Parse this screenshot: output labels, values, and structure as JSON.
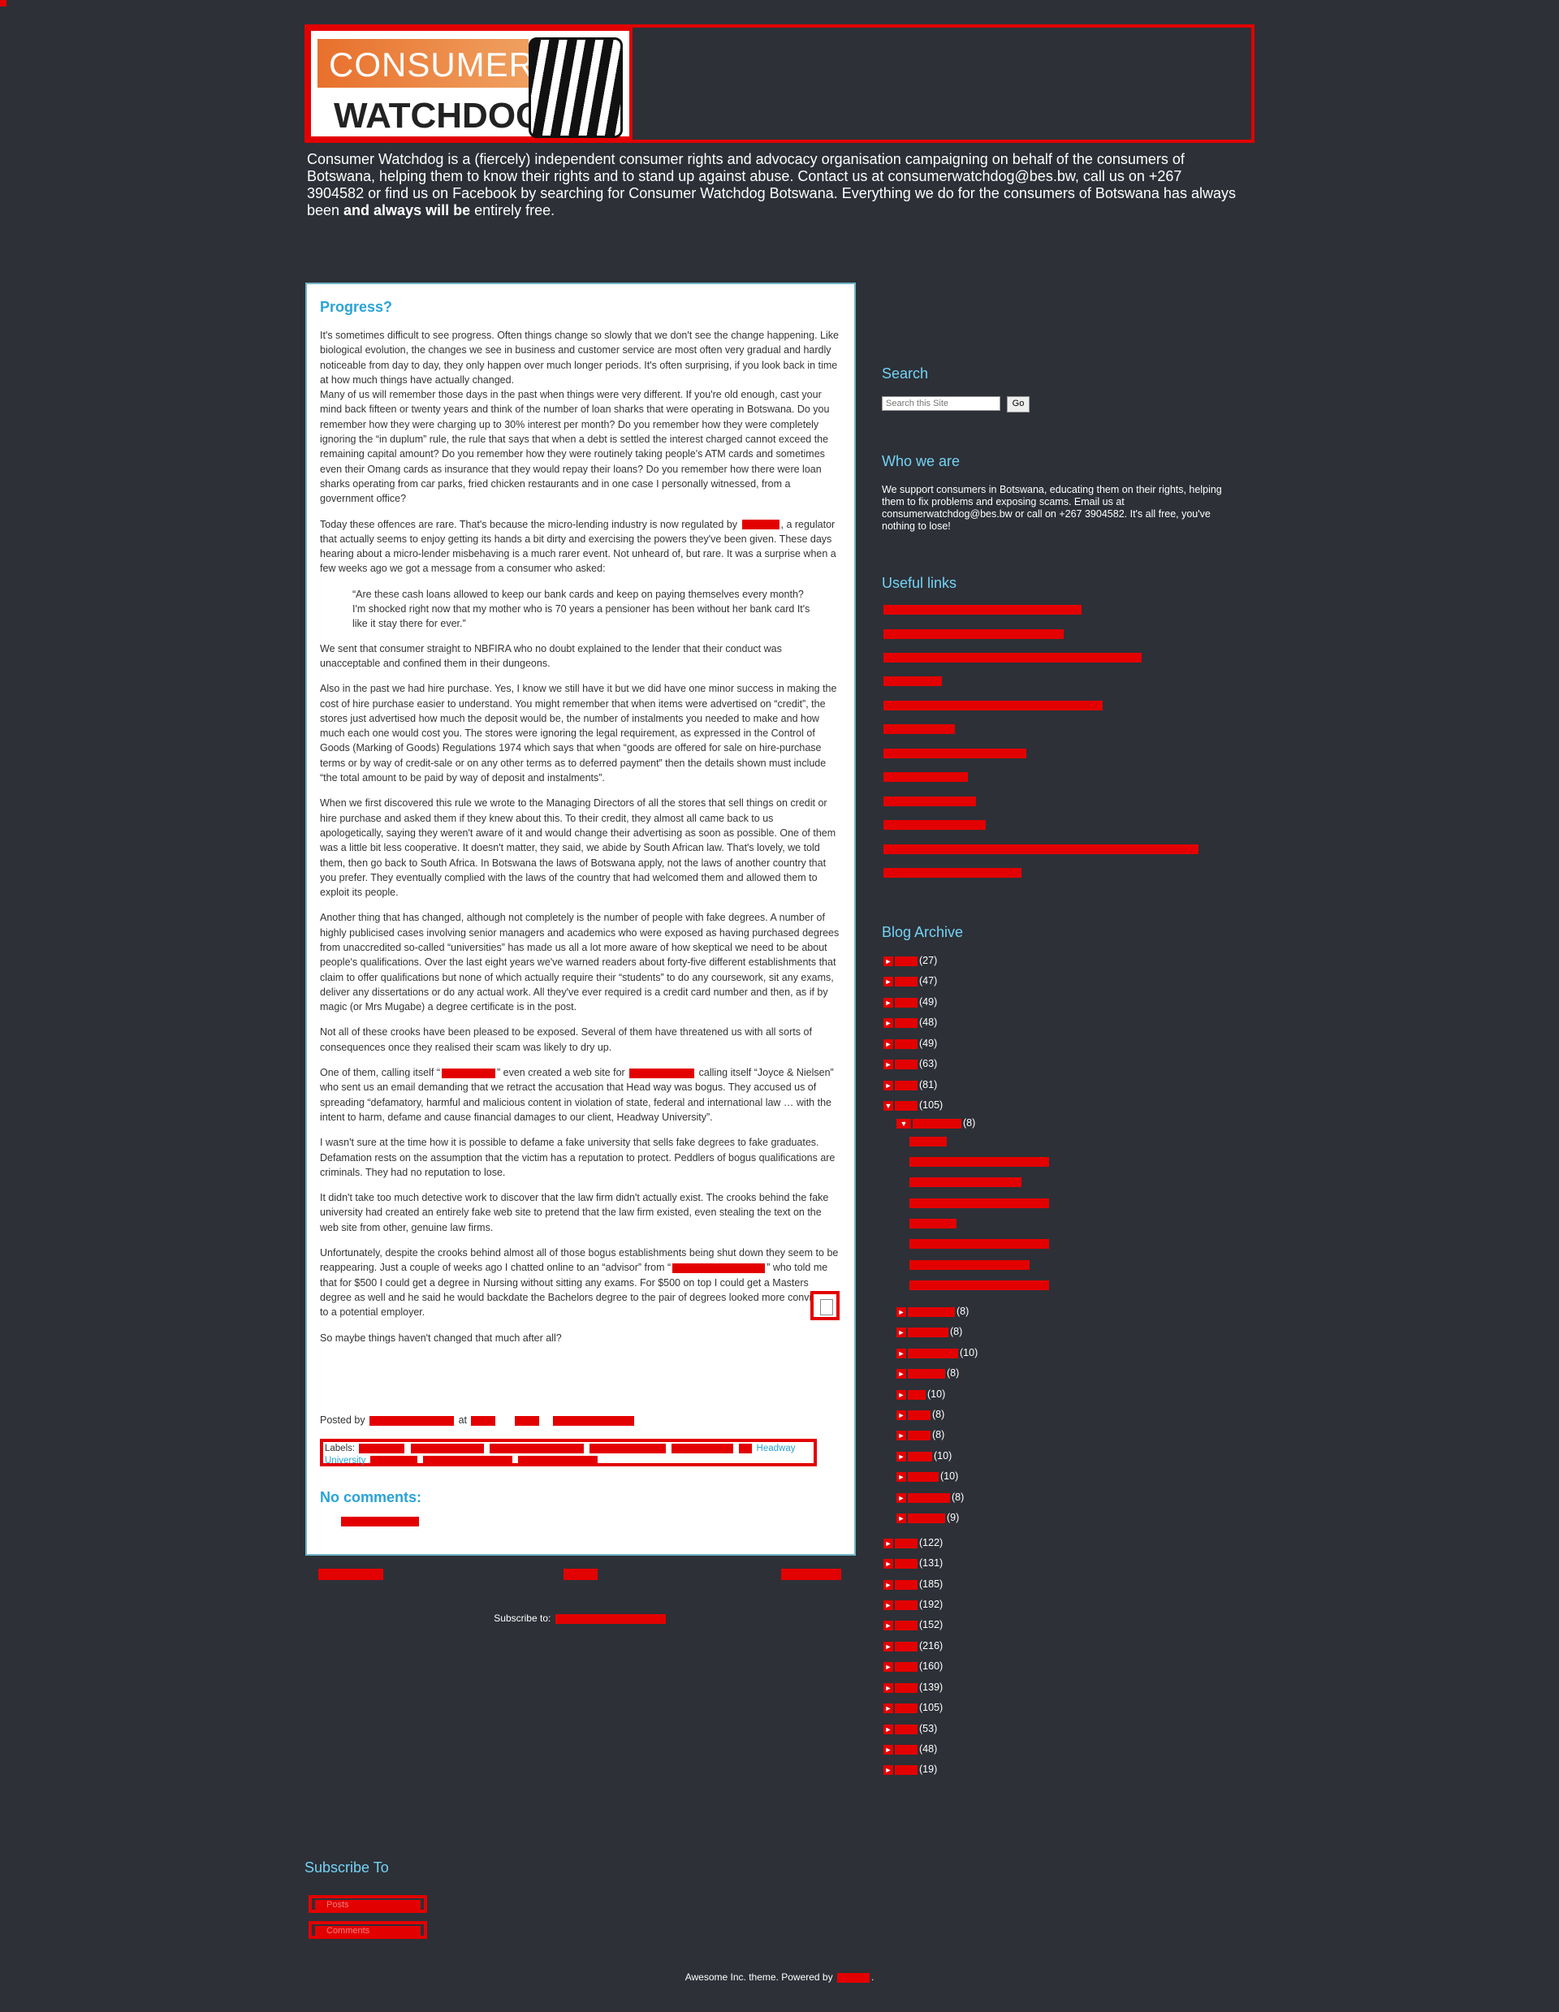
{
  "header": {
    "logo_line1": "CONSUMER",
    "logo_line2": "WATCHDOG",
    "description_part1": "Consumer Watchdog is a (fiercely) independent consumer rights and advocacy organisation campaigning on behalf of the consumers of Botswana, helping them to know their rights and to stand up against abuse. Contact us at consumerwatchdog@bes.bw, call us on +267 3904582 or find us on Facebook by searching for Consumer Watchdog Botswana. Everything we do for the consumers of Botswana has always been ",
    "description_bold": "and always will be",
    "description_part2": " entirely free."
  },
  "post": {
    "title": "Progress?",
    "p1": "It's sometimes difficult to see progress. Often things change so slowly that we don't see the change happening. Like biological evolution, the changes we see in business and customer service are most often very gradual and hardly noticeable from day to day, they only happen over much longer periods. It's often surprising, if you look back in time at how much things have actually changed.",
    "p2": "Many of us will remember those days in the past when things were very different. If you're old enough, cast your mind back fifteen or twenty years and think of the number of loan sharks that were operating in Botswana. Do you remember how they were charging up to 30% interest per month? Do you remember how they were completely ignoring the “in duplum” rule, the rule that says that when a debt is settled the interest charged cannot exceed the remaining capital amount? Do you remember how they were routinely taking people's ATM cards and sometimes even their Omang cards as insurance that they would repay their loans? Do you remember how there were loan sharks operating from car parks, fried chicken restaurants and in one case I personally witnessed, from a government office?",
    "p3a": "Today these offences are rare. That's because the micro-lending industry is now regulated by ",
    "p3b": ", a regulator that actually seems to enjoy getting its hands a bit dirty and exercising the powers they've been given. These days hearing about a micro-lender misbehaving is a much rarer event. Not unheard of, but rare. It was a surprise when a few weeks ago we got a message from a consumer who asked:",
    "quote": "“Are these cash loans allowed to keep our bank cards and keep on paying themselves every month? I'm shocked right now that my mother who is 70 years a pensioner has been without her bank card It's like it stay there for ever.”",
    "p4": "We sent that consumer straight to NBFIRA who no doubt explained to the lender that their conduct was unacceptable and confined them in their dungeons.",
    "p5": "Also in the past we had hire purchase. Yes, I know we still have it but we did have one minor success in making the cost of hire purchase easier to understand. You might remember that when items were advertised on “credit”, the stores just advertised how much the deposit would be, the number of instalments you needed to make and how much each one would cost you. The stores were ignoring the legal requirement, as expressed in the Control of Goods (Marking of Goods) Regulations 1974 which says that when “goods are offered for sale on hire-purchase terms or by way of credit-sale or on any other terms as to deferred payment” then the details shown must include “the total amount to be paid by way of deposit and instalments”.",
    "p6": "When we first discovered this rule we wrote to the Managing Directors of all the stores that sell things on credit or hire purchase and asked them if they knew about this. To their credit, they almost all came back to us apologetically, saying they weren't aware of it and would change their advertising as soon as possible. One of them was a little bit less cooperative. It doesn't matter, they said, we abide by South African law. That's lovely, we told them, then go back to South Africa. In Botswana the laws of Botswana apply, not the laws of another country that you prefer. They eventually complied with the laws of the country that had welcomed them and allowed them to exploit its people.",
    "p7": "Another thing that has changed, although not completely is the number of people with fake degrees. A number of highly publicised cases involving senior managers and academics who were exposed as having purchased degrees from unaccredited so-called “universities” has made us all a lot more aware of how skeptical we need to be about people's qualifications. Over the last eight years we've warned readers about forty-five different establishments that claim to offer qualifications but none of which actually require their “students” to do any coursework, sit any exams, deliver any dissertations or do any actual work. All they've ever required is a credit card number and then, as if by magic (or Mrs Mugabe) a degree certificate is in the post.",
    "p8": "Not all of these crooks have been pleased to be exposed. Several of them have threatened us with all sorts of consequences once they realised their scam was likely to dry up.",
    "p9a": "One of them, calling itself “",
    "p9b": "” even created a web site for ",
    "p9c": " calling itself “Joyce & Nielsen” who sent us an email demanding that we retract the accusation that Head way was bogus. They accused us of spreading “defamatory, harmful and malicious content in violation of state, federal and international law … with the intent to harm, defame and cause financial damages to our client, Headway University”.",
    "p10": "I wasn't sure at the time how it is possible to defame a fake university that sells fake degrees to fake graduates. Defamation rests on the assumption that the victim has a reputation to protect. Peddlers of bogus qualifications are criminals. They had no reputation to lose.",
    "p11": "It didn't take too much detective work to discover that the law firm didn't actually exist. The crooks behind the fake university had created an entirely fake web site to pretend that the law firm existed, even stealing the text on the web site from other, genuine law firms.",
    "p12a": "Unfortunately, despite the crooks behind almost all of those bogus establishments being shut down they seem to be reappearing. Just a couple of weeks ago I chatted online to an “advisor” from “",
    "p12b": "” who told me that for $500 I could get a degree in Nursing without sitting any exams. For $500 on top I could get a Masters degree as well and he said he would backdate the Bachelors degree to the pair of degrees looked more convincing to a potential employer.",
    "p13": "So maybe things haven't changed that much after all?",
    "posted_by": "Posted by",
    "at": "at",
    "labels_prefix": "Labels:",
    "labels_visible": "Headway",
    "labels_visible2": "University"
  },
  "comments": {
    "heading": "No comments:"
  },
  "pager": {
    "subscribe_prefix": "Subscribe to:"
  },
  "sidebar": {
    "search_title": "Search",
    "search_placeholder": "Search this Site",
    "search_button": "Go",
    "who_title": "Who we are",
    "who_text": "We support consumers in Botswana, educating them on their rights, helping them to fix problems and exposing scams. Email us at consumerwatchdog@bes.bw or call on +267 3904582. It's all free, you've nothing to lose!",
    "links_title": "Useful links",
    "archive_title": "Blog Archive"
  },
  "archive": {
    "years_top": [
      "(27)",
      "(47)",
      "(49)",
      "(48)",
      "(49)",
      "(63)",
      "(81)"
    ],
    "open_year_count": "(105)",
    "open_month_count": "(8)",
    "months": [
      "(8)",
      "(8)",
      "(10)",
      "(8)",
      "(10)",
      "(8)",
      "(8)",
      "(10)",
      "(10)",
      "(8)",
      "(9)"
    ],
    "years_bottom": [
      "(122)",
      "(131)",
      "(185)",
      "(192)",
      "(152)",
      "(216)",
      "(160)",
      "(139)",
      "(105)",
      "(53)",
      "(48)",
      "(19)"
    ]
  },
  "subscribe": {
    "title": "Subscribe To",
    "posts": "Posts",
    "comments": "Comments"
  },
  "footer": {
    "text": "Awesome Inc. theme. Powered by"
  }
}
